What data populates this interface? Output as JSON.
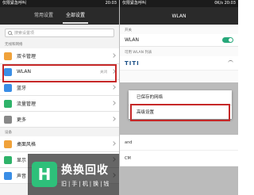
{
  "left": {
    "status": {
      "carrier": "仅限紧急呼叫",
      "time": "20:03"
    },
    "tabs": [
      {
        "label": "常用设置",
        "active": false
      },
      {
        "label": "全部设置",
        "active": true
      }
    ],
    "search_placeholder": "搜索设置项",
    "section_network": "无线和网络",
    "rows": [
      {
        "label": "双卡管理",
        "value": "",
        "icon": "dual-sim-icon",
        "color": "#f0a23a"
      },
      {
        "label": "WLAN",
        "value": "关闭",
        "icon": "wlan-icon",
        "color": "#3a8ee6"
      },
      {
        "label": "蓝牙",
        "value": "",
        "icon": "bluetooth-icon",
        "color": "#3a8ee6"
      },
      {
        "label": "流量管理",
        "value": "",
        "icon": "data-usage-icon",
        "color": "#2fb36a"
      },
      {
        "label": "更多",
        "value": "",
        "icon": "more-icon",
        "color": "#888888"
      }
    ],
    "section_device": "设备",
    "device_rows": [
      {
        "label": "桌面风格",
        "icon": "home-style-icon",
        "color": "#f0a23a"
      },
      {
        "label": "显示",
        "icon": "display-icon",
        "color": "#2fb36a"
      },
      {
        "label": "声音",
        "icon": "sound-icon",
        "color": "#3a8ee6"
      }
    ]
  },
  "right": {
    "status": {
      "carrier": "仅限紧急呼叫",
      "speed": "0K/s",
      "time": "20:03"
    },
    "title": "WLAN",
    "section_switch": "开关",
    "wlan_label": "WLAN",
    "wlan_on": true,
    "section_list": "可用 WLAN 列表",
    "network_name": "TITI",
    "menu": {
      "items": [
        "已保存的网络",
        "高级设置"
      ]
    },
    "bottom_network_1": "and",
    "bottom_network_2": "CM"
  },
  "watermark": {
    "logo_char": "H",
    "title": "换换回收",
    "subtitle": "旧|手|机|换|钱"
  },
  "colors": {
    "highlight": "#c62828",
    "toggle": "#27a87a"
  }
}
